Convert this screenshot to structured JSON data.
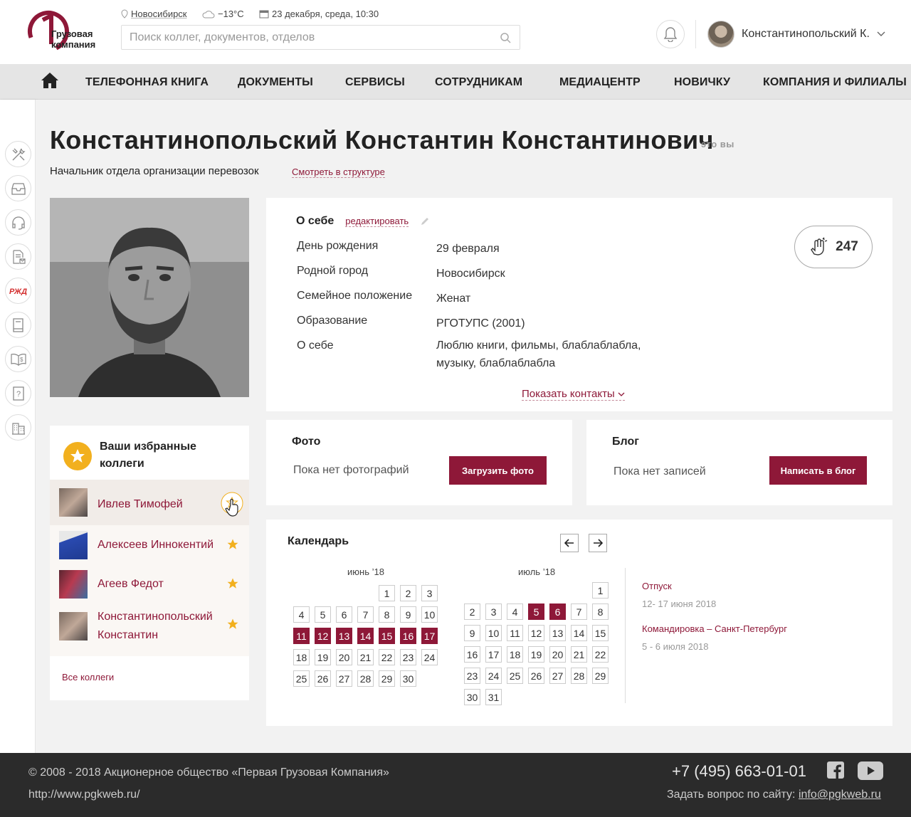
{
  "header": {
    "logo_text_line1": "Грузовая",
    "logo_text_line2": "компания",
    "city": "Новосибирск",
    "weather": "−13°C",
    "datetime": "23 декабря, среда, 10:30",
    "search_placeholder": "Поиск коллег, документов, отделов",
    "user_name": "Константинопольский К."
  },
  "nav": {
    "items": [
      "ТЕЛЕФОННАЯ КНИГА",
      "ДОКУМЕНТЫ",
      "СЕРВИСЫ",
      "СОТРУДНИКАМ",
      "МЕДИАЦЕНТР",
      "НОВИЧКУ",
      "КОМПАНИЯ И ФИЛИАЛЫ"
    ]
  },
  "side_rail": [
    "tools-icon",
    "inbox-icon",
    "headset-icon",
    "document-mail-icon",
    "rzd-icon",
    "book-icon",
    "book-money-icon",
    "help-book-icon",
    "building-icon"
  ],
  "profile": {
    "name": "Константинопольский Константин Константинович",
    "its_you": "это вы",
    "position": "Начальник отдела организации перевозок",
    "structure_link": "Смотреть в структуре"
  },
  "about": {
    "title": "О себе",
    "edit_link": "редактировать",
    "rows": [
      {
        "key": "День рождения",
        "value": "29 февраля"
      },
      {
        "key": "Родной город",
        "value": "Новосибирск"
      },
      {
        "key": "Семейное положение",
        "value": "Женат"
      },
      {
        "key": "Образование",
        "value": "РГОТУПС (2001)"
      },
      {
        "key": "О себе",
        "value": "Люблю книги, фильмы, блаблаблабла, музыку, блаблаблабла"
      }
    ],
    "applause_count": "247",
    "show_contacts": "Показать контакты"
  },
  "favorites": {
    "title": "Ваши избранные коллеги",
    "items": [
      {
        "name": "Ивлев Тимофей"
      },
      {
        "name": "Алексеев Иннокентий"
      },
      {
        "name": "Агеев Федот"
      },
      {
        "name": "Константинопольский Константин"
      }
    ],
    "all_link": "Все коллеги"
  },
  "photo_block": {
    "title": "Фото",
    "empty": "Пока нет фотографий",
    "button": "Загрузить фото"
  },
  "blog_block": {
    "title": "Блог",
    "empty": "Пока нет записей",
    "button": "Написать в блог"
  },
  "calendar": {
    "title": "Календарь",
    "months": [
      {
        "title": "июнь ’18",
        "first_weekday": 5,
        "days": 30,
        "highlighted": [
          11,
          12,
          13,
          14,
          15,
          16,
          17
        ]
      },
      {
        "title": "июль ’18",
        "first_weekday": 7,
        "days": 31,
        "highlighted": [
          5,
          6
        ]
      }
    ],
    "events": [
      {
        "name": "Отпуск",
        "dates": "12- 17 июня 2018"
      },
      {
        "name": "Командировка – Санкт-Петербург",
        "dates": "5 - 6 июля 2018"
      }
    ]
  },
  "footer": {
    "copyright": "© 2008 - 2018 Акционерное общество «Первая Грузовая Компания»",
    "url": "http://www.pgkweb.ru/",
    "phone": "+7 (495) 663-01-01",
    "question_label": "Задать вопрос по сайту:",
    "email": "info@pgkweb.ru"
  },
  "colors": {
    "accent": "#8e1838",
    "star": "#f2b01e",
    "footer_bg": "#2b2b2b"
  }
}
